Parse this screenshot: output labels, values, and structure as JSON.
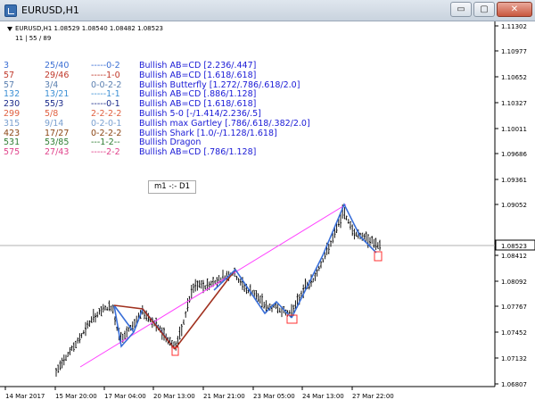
{
  "window": {
    "title": "EURUSD,H1",
    "buttons": {
      "minimize": "▭",
      "maximize": "▢",
      "close": "✕"
    }
  },
  "chart_info": {
    "symbol_line": "EURUSD,H1  1.08529 1.08540 1.08482 1.08523",
    "sub_line": "11 | 55 / 89"
  },
  "timeframe_label": "m1 -:- D1",
  "current_price": "1.08523",
  "patterns": [
    {
      "c1": "3",
      "c2": "25/40",
      "c3": "-----0-2",
      "c4": "Bullish AB=CD [2.236/.447]",
      "color1": "#3b6fd4",
      "color2": "#3b6fd4",
      "color3": "#3b6fd4",
      "color4": "#1a1ad6"
    },
    {
      "c1": "57",
      "c2": "29/46",
      "c3": "-----1-0",
      "c4": "Bullish AB=CD [1.618/.618]",
      "color1": "#c0392b",
      "color2": "#c0392b",
      "color3": "#c0392b",
      "color4": "#1a1ad6"
    },
    {
      "c1": "57",
      "c2": "3/4",
      "c3": "0-0-2-2",
      "c4": "Bullish Butterfly [1.272/.786/.618/2.0]",
      "color1": "#5a7fb0",
      "color2": "#5a7fb0",
      "color3": "#5a7fb0",
      "color4": "#1a1ad6"
    },
    {
      "c1": "132",
      "c2": "13/21",
      "c3": "-----1-1",
      "c4": "Bullish AB=CD [.886/1.128]",
      "color1": "#3b8fd4",
      "color2": "#3b8fd4",
      "color3": "#3b8fd4",
      "color4": "#1a1ad6"
    },
    {
      "c1": "230",
      "c2": "55/3",
      "c3": "-----0-1",
      "c4": "Bullish AB=CD [1.618/.618]",
      "color1": "#1a2a8a",
      "color2": "#1a2a8a",
      "color3": "#1a2a8a",
      "color4": "#1a1ad6"
    },
    {
      "c1": "299",
      "c2": "5/8",
      "c3": "2-2-2-2",
      "c4": "Bullish 5-0 [-/1.414/2.236/.5]",
      "color1": "#e06040",
      "color2": "#e06040",
      "color3": "#e06040",
      "color4": "#1a1ad6"
    },
    {
      "c1": "315",
      "c2": "9/14",
      "c3": "0-2-0-1",
      "c4": "Bullish max Gartley [.786/.618/.382/2.0]",
      "color1": "#7aa0d0",
      "color2": "#7aa0d0",
      "color3": "#7aa0d0",
      "color4": "#1a1ad6"
    },
    {
      "c1": "423",
      "c2": "17/27",
      "c3": "0-2-2-2",
      "c4": "Bullish Shark [1.0/-/1.128/1.618]",
      "color1": "#8b4513",
      "color2": "#8b4513",
      "color3": "#8b4513",
      "color4": "#1a1ad6"
    },
    {
      "c1": "531",
      "c2": "53/85",
      "c3": "---1-2--",
      "c4": "Bullish Dragon",
      "color1": "#2e7d32",
      "color2": "#2e7d32",
      "color3": "#2e7d32",
      "color4": "#1a1ad6"
    },
    {
      "c1": "575",
      "c2": "27/43",
      "c3": "-----2-2",
      "c4": "Bullish AB=CD [.786/1.128]",
      "color1": "#e0408a",
      "color2": "#e0408a",
      "color3": "#e0408a",
      "color4": "#1a1ad6"
    }
  ],
  "y_axis_ticks": [
    "1.11302",
    "1.10977",
    "1.10652",
    "1.10327",
    "1.10011",
    "1.09686",
    "1.09361",
    "1.09052",
    "1.08412",
    "1.08092",
    "1.07767",
    "1.07452",
    "1.07132",
    "1.06807"
  ],
  "x_axis_ticks": [
    "14 Mar 2017",
    "15 Mar 20:00",
    "17 Mar 04:00",
    "20 Mar 13:00",
    "21 Mar 21:00",
    "23 Mar 05:00",
    "24 Mar 13:00",
    "27 Mar 22:00"
  ],
  "colors": {
    "pattern_blue": "#3a6fd8",
    "pattern_brown": "#a0301e",
    "trendline": "#ff40ff",
    "bars": "#000000",
    "marker": "#ff3030",
    "price_line": "#b0b0b0"
  }
}
